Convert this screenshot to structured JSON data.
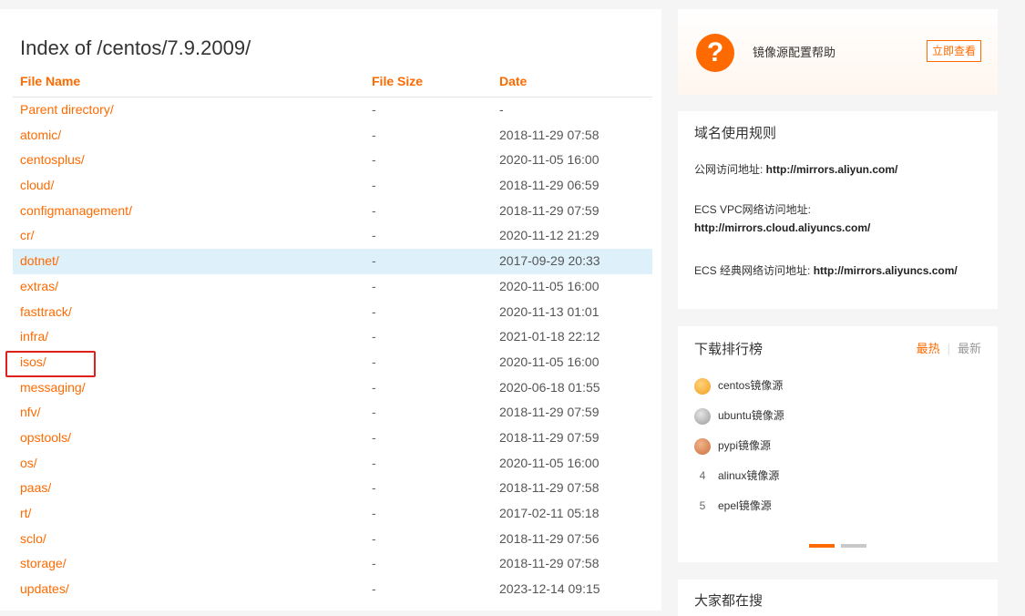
{
  "listing": {
    "title": "Index of /centos/7.9.2009/",
    "headers": {
      "name": "File Name",
      "size": "File Size",
      "date": "Date"
    },
    "rows": [
      {
        "name": "Parent directory/",
        "size": "-",
        "date": "-"
      },
      {
        "name": "atomic/",
        "size": "-",
        "date": "2018-11-29 07:58"
      },
      {
        "name": "centosplus/",
        "size": "-",
        "date": "2020-11-05 16:00"
      },
      {
        "name": "cloud/",
        "size": "-",
        "date": "2018-11-29 06:59"
      },
      {
        "name": "configmanagement/",
        "size": "-",
        "date": "2018-11-29 07:59"
      },
      {
        "name": "cr/",
        "size": "-",
        "date": "2020-11-12 21:29"
      },
      {
        "name": "dotnet/",
        "size": "-",
        "date": "2017-09-29 20:33"
      },
      {
        "name": "extras/",
        "size": "-",
        "date": "2020-11-05 16:00"
      },
      {
        "name": "fasttrack/",
        "size": "-",
        "date": "2020-11-13 01:01"
      },
      {
        "name": "infra/",
        "size": "-",
        "date": "2021-01-18 22:12"
      },
      {
        "name": "isos/",
        "size": "-",
        "date": "2020-11-05 16:00"
      },
      {
        "name": "messaging/",
        "size": "-",
        "date": "2020-06-18 01:55"
      },
      {
        "name": "nfv/",
        "size": "-",
        "date": "2018-11-29 07:59"
      },
      {
        "name": "opstools/",
        "size": "-",
        "date": "2018-11-29 07:59"
      },
      {
        "name": "os/",
        "size": "-",
        "date": "2020-11-05 16:00"
      },
      {
        "name": "paas/",
        "size": "-",
        "date": "2018-11-29 07:58"
      },
      {
        "name": "rt/",
        "size": "-",
        "date": "2017-02-11 05:18"
      },
      {
        "name": "sclo/",
        "size": "-",
        "date": "2018-11-29 07:56"
      },
      {
        "name": "storage/",
        "size": "-",
        "date": "2018-11-29 07:58"
      },
      {
        "name": "updates/",
        "size": "-",
        "date": "2023-12-14 09:15"
      }
    ],
    "highlighted_row": "dotnet/",
    "annotated_row": "isos/"
  },
  "help_card": {
    "icon": "question-icon",
    "text": "镜像源配置帮助",
    "button": "立即查看"
  },
  "rules_card": {
    "title": "域名使用规则",
    "public_label": "公网访问地址: ",
    "public_url": "http://mirrors.aliyun.com/",
    "vpc_label": "ECS VPC网络访问地址:",
    "vpc_url": "http://mirrors.cloud.aliyuncs.com/",
    "classic_label": "ECS 经典网络访问地址: ",
    "classic_url": "http://mirrors.aliyuncs.com/"
  },
  "ranking": {
    "title": "下载排行榜",
    "tab_hot": "最热",
    "tab_new": "最新",
    "items": [
      {
        "rank": "1",
        "label": "centos镜像源",
        "icon": "gold-medal-icon"
      },
      {
        "rank": "2",
        "label": "ubuntu镜像源",
        "icon": "silver-medal-icon"
      },
      {
        "rank": "3",
        "label": "pypi镜像源",
        "icon": "bronze-medal-icon"
      },
      {
        "rank": "4",
        "label": "alinux镜像源"
      },
      {
        "rank": "5",
        "label": "epel镜像源"
      }
    ]
  },
  "search_card": {
    "title": "大家都在搜"
  },
  "colors": {
    "accent": "#ff6a00",
    "highlight": "#def0fa",
    "annotation": "#e0201c"
  }
}
